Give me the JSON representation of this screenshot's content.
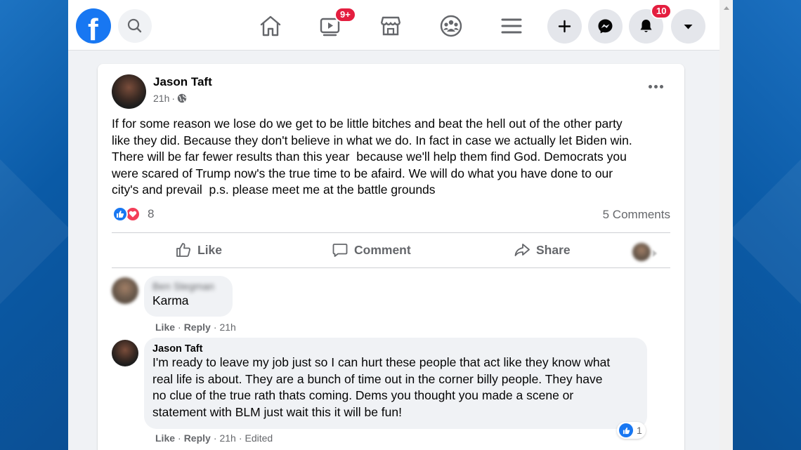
{
  "nav": {
    "video_badge": "9+",
    "notifications_badge": "10",
    "icons": [
      "facebook-logo",
      "search-icon",
      "home-icon",
      "watch-icon",
      "marketplace-icon",
      "groups-icon",
      "menu-icon",
      "create-icon",
      "messenger-icon",
      "notifications-icon",
      "account-caret-icon"
    ]
  },
  "post": {
    "author": "Jason Taft",
    "time": "21h",
    "separator": "·",
    "text": "If for some reason we lose do we get to be little bitches and beat the hell out of the other party\nlike they did. Because they don't believe in what we do. In fact in case we actually let Biden win.\nThere will be far fewer results than this year  because we'll help them find God. Democrats you\nwere scared of Trump now's the true time to be afaird. We will do what you have done to our\ncity's and prevail  p.s. please meet me at the battle grounds",
    "reaction_count": "8",
    "comments_count": "5 Comments"
  },
  "actions": {
    "like": "Like",
    "comment": "Comment",
    "share": "Share"
  },
  "comments": [
    {
      "author": "Ben Stegman",
      "text": "Karma",
      "like": "Like",
      "reply": "Reply",
      "time": "21h"
    },
    {
      "author": "Jason Taft",
      "text": "I'm ready to leave my job just so I can hurt these people that act like they know what\nreal life is about. They are a bunch of time out in the corner billy people. They have\nno clue of the true rath thats coming. Dems you thought you made a scene or\nstatement with BLM just wait this it will be fun!",
      "like": "Like",
      "reply": "Reply",
      "time": "21h",
      "edited": "Edited",
      "reaction_count": "1"
    }
  ],
  "colors": {
    "brand": "#1877f2",
    "badge": "#e41e3f",
    "love": "#f33e58"
  }
}
